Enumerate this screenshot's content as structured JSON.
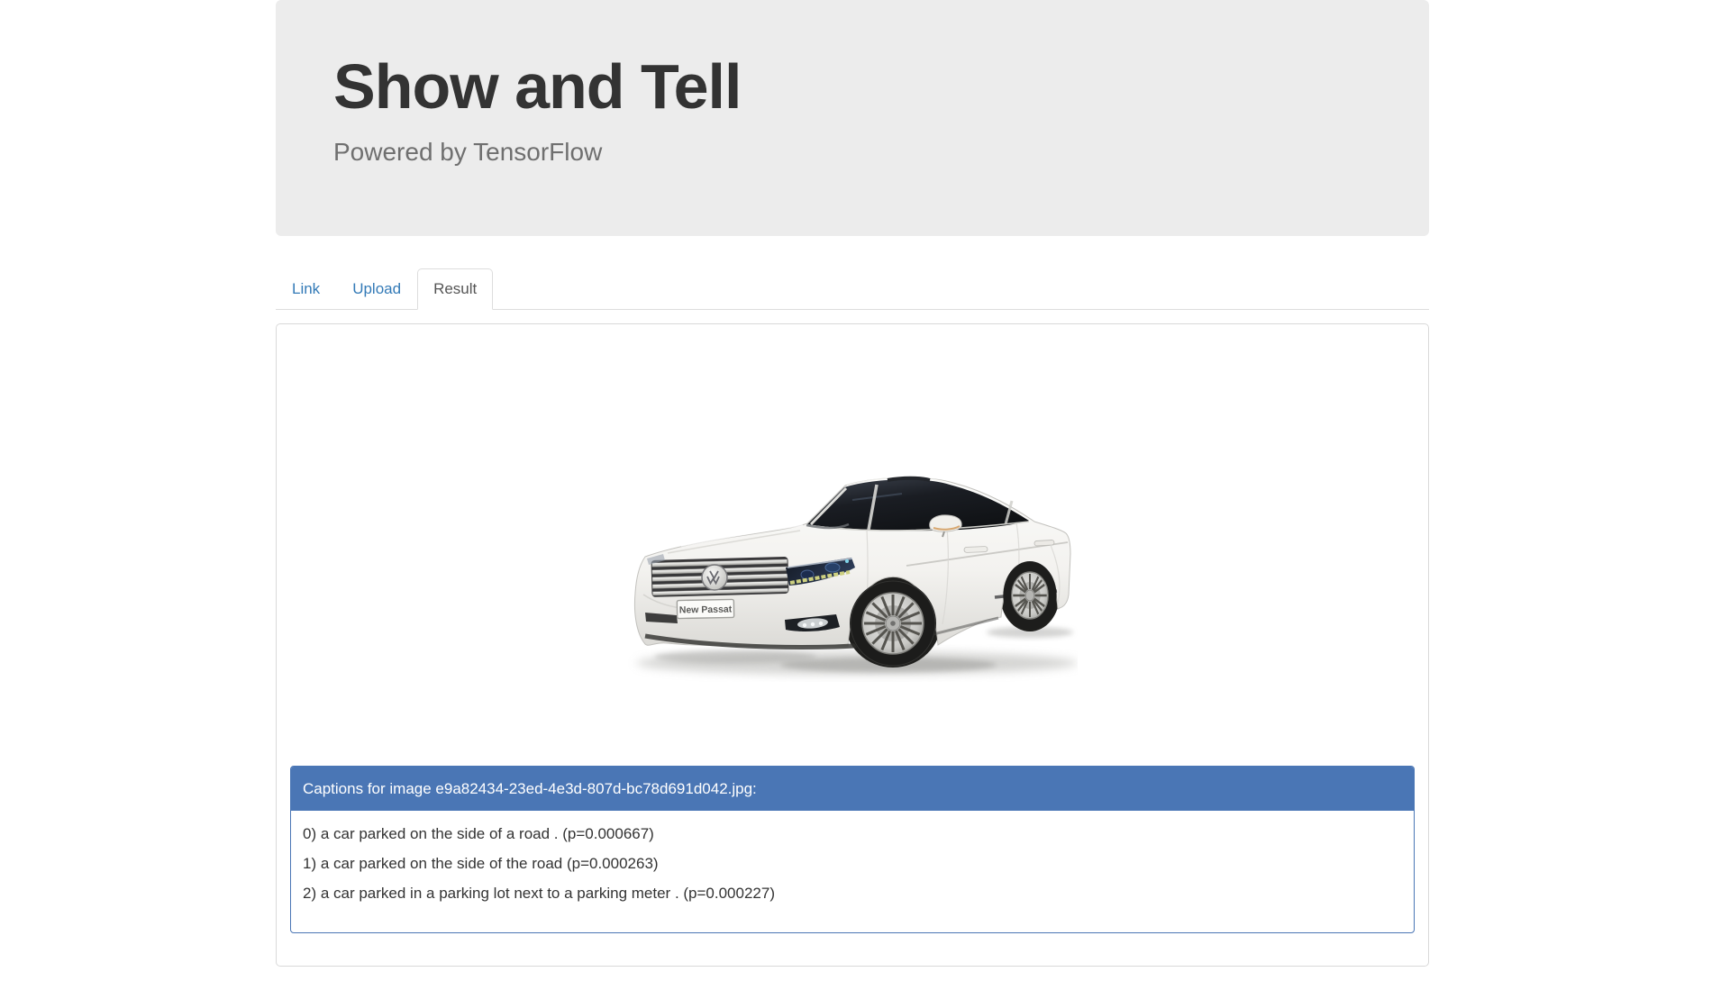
{
  "header": {
    "title": "Show and Tell",
    "subtitle": "Powered by TensorFlow"
  },
  "tabs": [
    {
      "label": "Link",
      "active": false
    },
    {
      "label": "Upload",
      "active": false
    },
    {
      "label": "Result",
      "active": true
    }
  ],
  "result": {
    "image_description": "white Volkswagen New Passat sedan, front three-quarter view",
    "plate_text": "New Passat",
    "captions_header": "Captions for image e9a82434-23ed-4e3d-807d-bc78d691d042.jpg:",
    "captions": [
      "0) a car parked on the side of a road . (p=0.000667)",
      "1) a car parked on the side of the road (p=0.000263)",
      "2) a car parked in a parking lot next to a parking meter . (p=0.000227)"
    ]
  },
  "colors": {
    "jumbotron_bg": "#ececec",
    "title_text": "#333333",
    "subtitle_text": "#6f6f6f",
    "tab_link_blue": "#337ab7",
    "active_tab_text": "#555555",
    "panel_border": "#d9d9d9",
    "captions_accent_blue": "#4a76b5",
    "caption_text": "#333333"
  }
}
